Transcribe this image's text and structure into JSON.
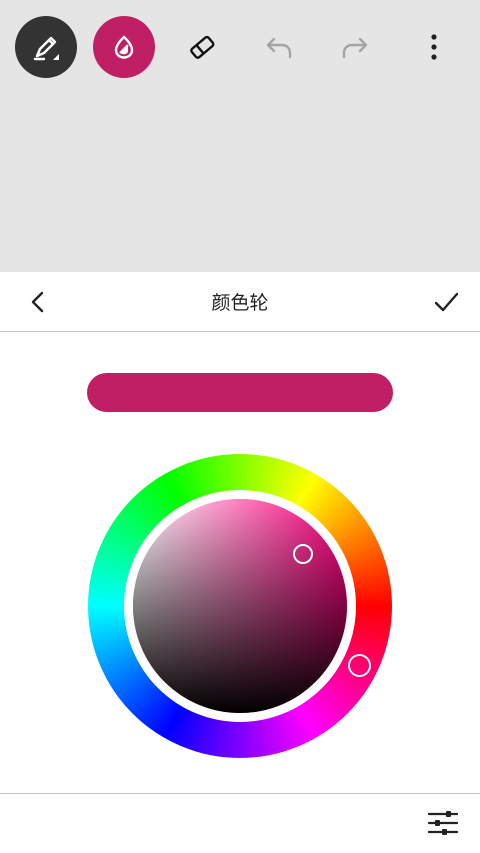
{
  "toolbar": {
    "tools": [
      {
        "icon": "pen-icon",
        "active": true
      },
      {
        "icon": "color-drop-icon",
        "active": true
      },
      {
        "icon": "eraser-icon",
        "active": false
      },
      {
        "icon": "undo-icon",
        "active": false
      },
      {
        "icon": "redo-icon",
        "active": false
      },
      {
        "icon": "more-vertical-icon",
        "active": false
      }
    ]
  },
  "panel": {
    "title": "颜色轮",
    "back_icon": "chevron-left-icon",
    "confirm_icon": "check-icon",
    "settings_icon": "sliders-icon"
  },
  "colors": {
    "accent": "#c01f63",
    "selected_hue": "#ff0080",
    "canvas_background": "#e6e5e5",
    "pen_button": "#333333"
  }
}
